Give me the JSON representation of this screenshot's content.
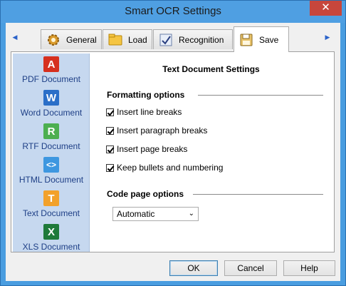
{
  "window": {
    "title": "Smart OCR Settings",
    "close_glyph": "✕"
  },
  "tabs": [
    {
      "label": "General",
      "icon": "gear-icon"
    },
    {
      "label": "Load",
      "icon": "folder-icon"
    },
    {
      "label": "Recognition",
      "icon": "recognition-icon"
    },
    {
      "label": "Save",
      "icon": "floppy-disk-icon",
      "active": true
    }
  ],
  "tab_nav": {
    "left_glyph": "◀",
    "right_glyph": "▶"
  },
  "sidebar": {
    "items": [
      {
        "label": "PDF Document",
        "icon": "pdf-icon",
        "glyph": "A",
        "color": "#d6301f"
      },
      {
        "label": "Word Document",
        "icon": "word-icon",
        "glyph": "W",
        "color": "#2b6fc8"
      },
      {
        "label": "RTF Document",
        "icon": "rtf-icon",
        "glyph": "R",
        "color": "#4caf50"
      },
      {
        "label": "HTML Document",
        "icon": "html-icon",
        "glyph": "<>",
        "color": "#3e97e0"
      },
      {
        "label": "Text Document",
        "icon": "text-icon",
        "glyph": "T",
        "color": "#f2a12b",
        "selected": true
      },
      {
        "label": "XLS Document",
        "icon": "excel-icon",
        "glyph": "X",
        "color": "#1f7a3a"
      }
    ]
  },
  "content": {
    "heading": "Text Document Settings",
    "formatting": {
      "title": "Formatting options",
      "options": [
        {
          "label": "Insert line breaks",
          "checked": true
        },
        {
          "label": "Insert paragraph breaks",
          "checked": true
        },
        {
          "label": "Insert page breaks",
          "checked": true
        },
        {
          "label": "Keep bullets and numbering",
          "checked": true
        }
      ]
    },
    "code_page": {
      "title": "Code page options",
      "selected": "Automatic",
      "chevron": "⌄"
    }
  },
  "buttons": {
    "ok": "OK",
    "cancel": "Cancel",
    "help": "Help"
  }
}
